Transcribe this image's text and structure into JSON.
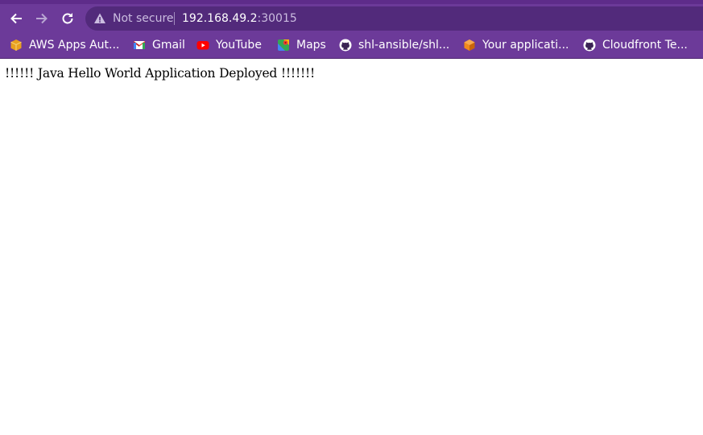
{
  "browser": {
    "security_label": "Not secure",
    "url_host": "192.168.49.2",
    "url_port": ":30015",
    "colors": {
      "frame": "#6c3a99",
      "omnibox": "#522a7b"
    }
  },
  "bookmarks": [
    {
      "label": "AWS Apps Aut...",
      "icon": "aws-box-icon"
    },
    {
      "label": "Gmail",
      "icon": "gmail-icon"
    },
    {
      "label": "YouTube",
      "icon": "youtube-icon"
    },
    {
      "label": "Maps",
      "icon": "maps-icon"
    },
    {
      "label": "shl-ansible/shl...",
      "icon": "github-icon"
    },
    {
      "label": "Your applicati...",
      "icon": "cube-icon"
    },
    {
      "label": "Cloudfront Te...",
      "icon": "github-icon"
    }
  ],
  "page": {
    "body_text": "!!!!!! Java Hello World Application Deployed !!!!!!!"
  }
}
